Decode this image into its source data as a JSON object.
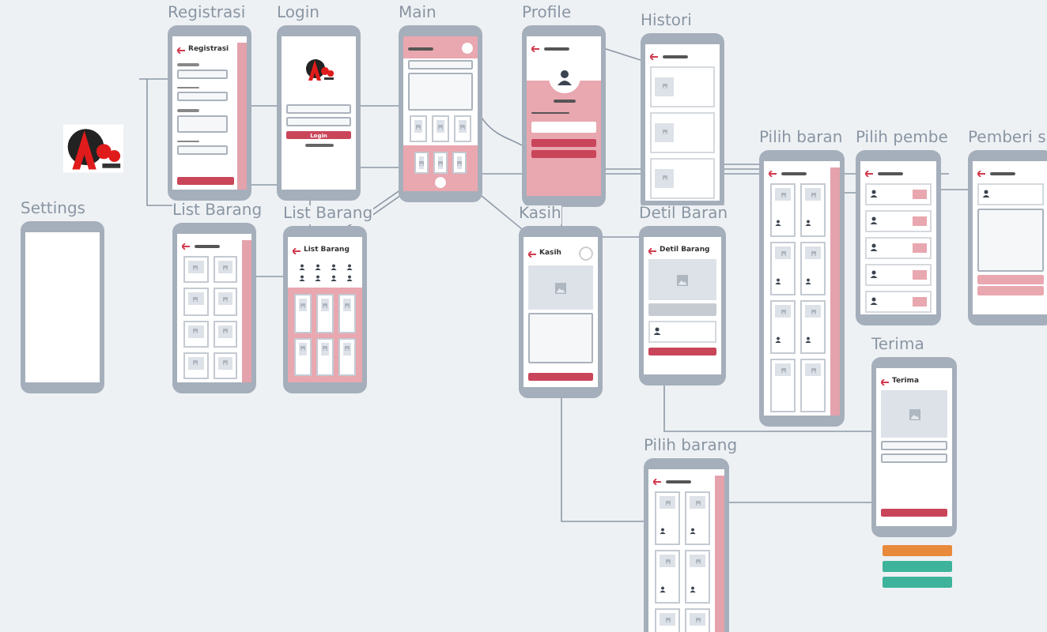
{
  "screens": [
    {
      "label": "Settings",
      "kind": "blank"
    },
    {
      "label": "Registrasi",
      "kind": "form",
      "header": "Registrasi"
    },
    {
      "label": "Login",
      "kind": "login",
      "button": "Login"
    },
    {
      "label": "Main",
      "kind": "main"
    },
    {
      "label": "Profile",
      "kind": "profile"
    },
    {
      "label": "Histori",
      "kind": "history"
    },
    {
      "label": "List Barang",
      "kind": "list"
    },
    {
      "label": "List Barang",
      "kind": "catalog",
      "header": "List Barang"
    },
    {
      "label": "Kasih",
      "kind": "give",
      "header": "Kasih"
    },
    {
      "label": "Detil Baran",
      "kind": "detail",
      "header": "Detil Barang"
    },
    {
      "label": "Pilih baran",
      "kind": "list"
    },
    {
      "label": "Pilih pembe",
      "kind": "people"
    },
    {
      "label": "Pemberi s",
      "kind": "giver"
    },
    {
      "label": "Terima",
      "kind": "receive",
      "header": "Terima"
    },
    {
      "label": "Pilih barang",
      "kind": "list"
    }
  ],
  "status_buttons": [
    {
      "color": "#e8893c"
    },
    {
      "color": "#3db39b"
    },
    {
      "color": "#3db39b"
    }
  ]
}
